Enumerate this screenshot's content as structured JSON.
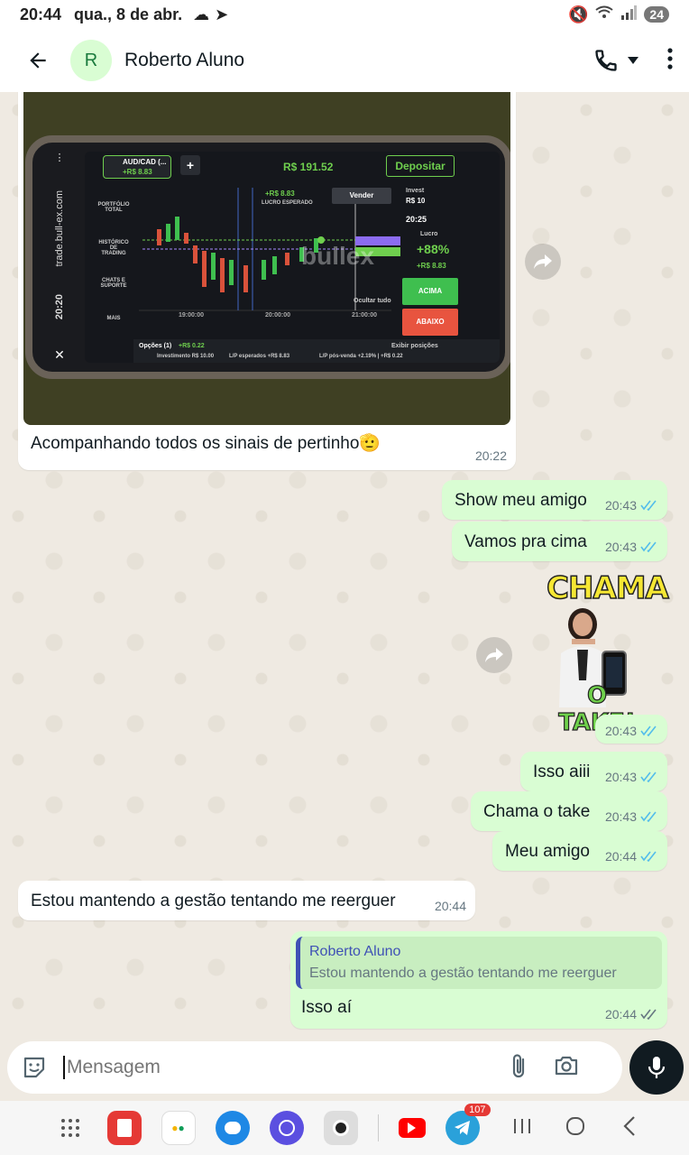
{
  "status_bar": {
    "time": "20:44",
    "date": "qua., 8 de abr.",
    "battery": "24"
  },
  "header": {
    "avatar_letter": "R",
    "contact_name": "Roberto Aluno"
  },
  "photo_screen": {
    "asset": "AUD/CAD (...",
    "asset_profit": "+R$ 8.83",
    "balance": "R$ 191.52",
    "deposit": "Depositar",
    "sell": "Vender",
    "invest_label": "Invest",
    "invest_value": "R$ 10",
    "timer": "20:25",
    "profit_label": "Lucro",
    "profit_pct": "+88%",
    "profit_value": "+R$ 8.83",
    "up": "ACIMA",
    "down": "ABAIXO",
    "watermark": "bullex",
    "url": "trade.bull-ex.com",
    "clock": "20:20",
    "expected_label": "LUCRO ESPERADO",
    "expected_value": "+R$ 8.83",
    "options": "Opções (1)",
    "options_value": "+R$ 0.22",
    "show_positions": "Exibir posições",
    "investment": "Investimento R$ 10.00",
    "lp_expected": "L/P esperados +R$ 8.83",
    "lp_after": "L/P pós-venda +2.19% | +R$ 0.22",
    "hide_all": "Ocultar tudo",
    "times": [
      "19:00:00",
      "20:00:00",
      "21:00:00"
    ],
    "menu": [
      "PORTFÓLIO TOTAL",
      "HISTÓRICO DE TRADING",
      "CHATS E SUPORTE",
      "MAIS"
    ]
  },
  "messages": [
    {
      "dir": "in",
      "text": "Acompanhando todos os sinais de pertinho🫡",
      "time": "20:22"
    },
    {
      "dir": "out",
      "text": "Show meu amigo",
      "time": "20:43"
    },
    {
      "dir": "out",
      "text": "Vamos pra cima",
      "time": "20:43"
    },
    {
      "dir": "out",
      "sticker_top": "CHAMA",
      "sticker_bottom": "O TAKE!",
      "time": "20:43"
    },
    {
      "dir": "out",
      "text": "Isso aiii",
      "time": "20:43"
    },
    {
      "dir": "out",
      "text": "Chama o take",
      "time": "20:43"
    },
    {
      "dir": "out",
      "text": "Meu amigo",
      "time": "20:44"
    },
    {
      "dir": "in",
      "text": "Estou mantendo a gestão tentando me reerguer",
      "time": "20:44"
    },
    {
      "dir": "out",
      "quote_author": "Roberto Aluno",
      "quote_text": "Estou mantendo a gestão tentando me reerguer",
      "text": "Isso aí",
      "time": "20:44"
    }
  ],
  "input": {
    "placeholder": "Mensagem"
  },
  "navbar": {
    "telegram_badge": "107"
  },
  "colors": {
    "outgoing": "#d9fdd3",
    "incoming": "#ffffff",
    "wallpaper": "#efeae2",
    "read_tick": "#53bdeb"
  }
}
